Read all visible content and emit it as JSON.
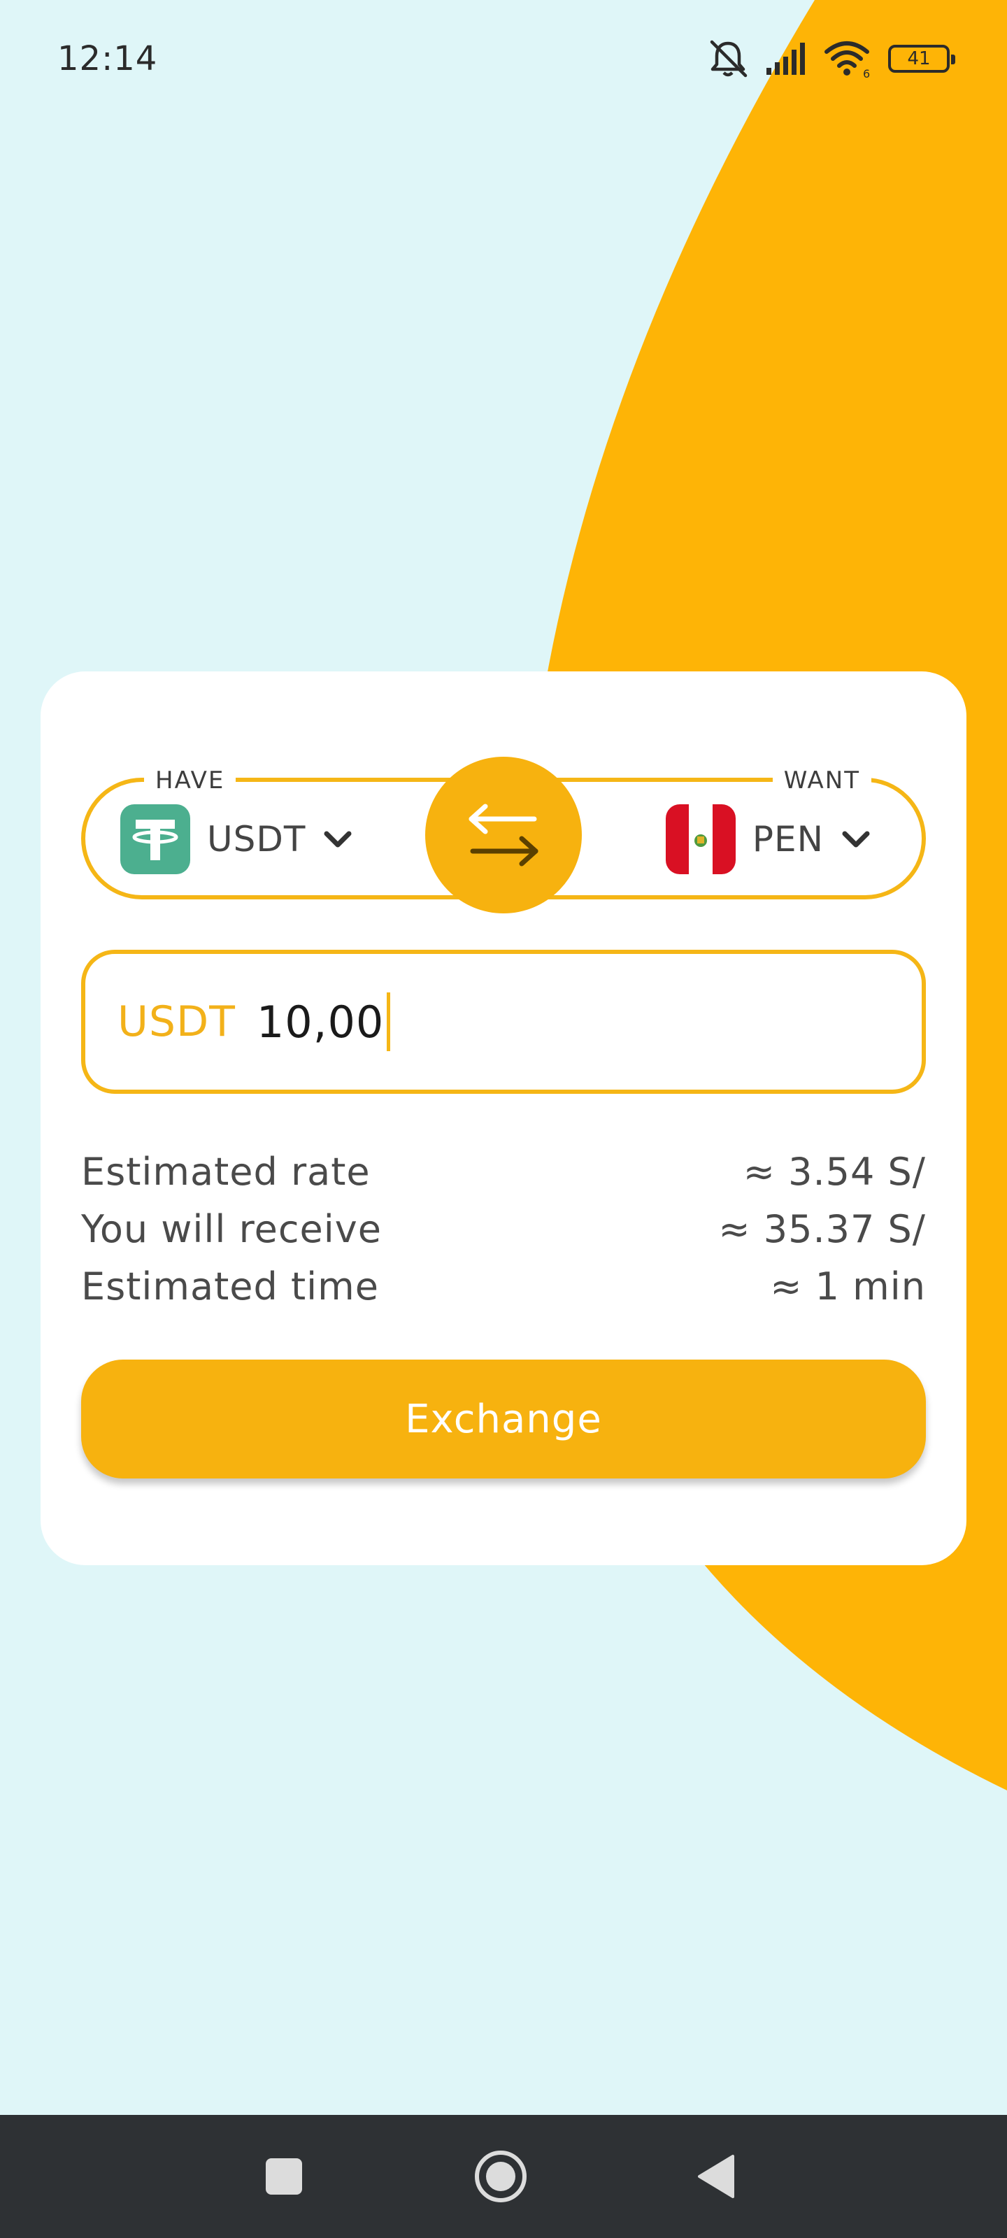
{
  "status_bar": {
    "time": "12:14",
    "battery_level": "41",
    "icons": [
      "mute-notifications-icon",
      "signal-icon",
      "wifi-icon",
      "battery-icon"
    ]
  },
  "exchange": {
    "have_label": "HAVE",
    "want_label": "WANT",
    "from": {
      "code": "USDT",
      "icon": "tether-icon"
    },
    "to": {
      "code": "PEN",
      "icon": "peru-flag-icon"
    },
    "amount": {
      "currency": "USDT",
      "value": "10,00"
    },
    "details": [
      {
        "label": "Estimated rate",
        "value": "≈ 3.54 S/"
      },
      {
        "label": "You will receive",
        "value": "≈ 35.37 S/"
      },
      {
        "label": "Estimated time",
        "value": "≈ 1 min"
      }
    ],
    "button_label": "Exchange"
  },
  "colors": {
    "accent": "#f7b20f",
    "background": "#dff6f8",
    "card": "#ffffff",
    "tether": "#4caf8f",
    "peru_red": "#d91023",
    "nav_bar": "#2e3134"
  },
  "nav_bar": {
    "icons": [
      "recents-square-icon",
      "home-circle-icon",
      "back-triangle-icon"
    ]
  }
}
